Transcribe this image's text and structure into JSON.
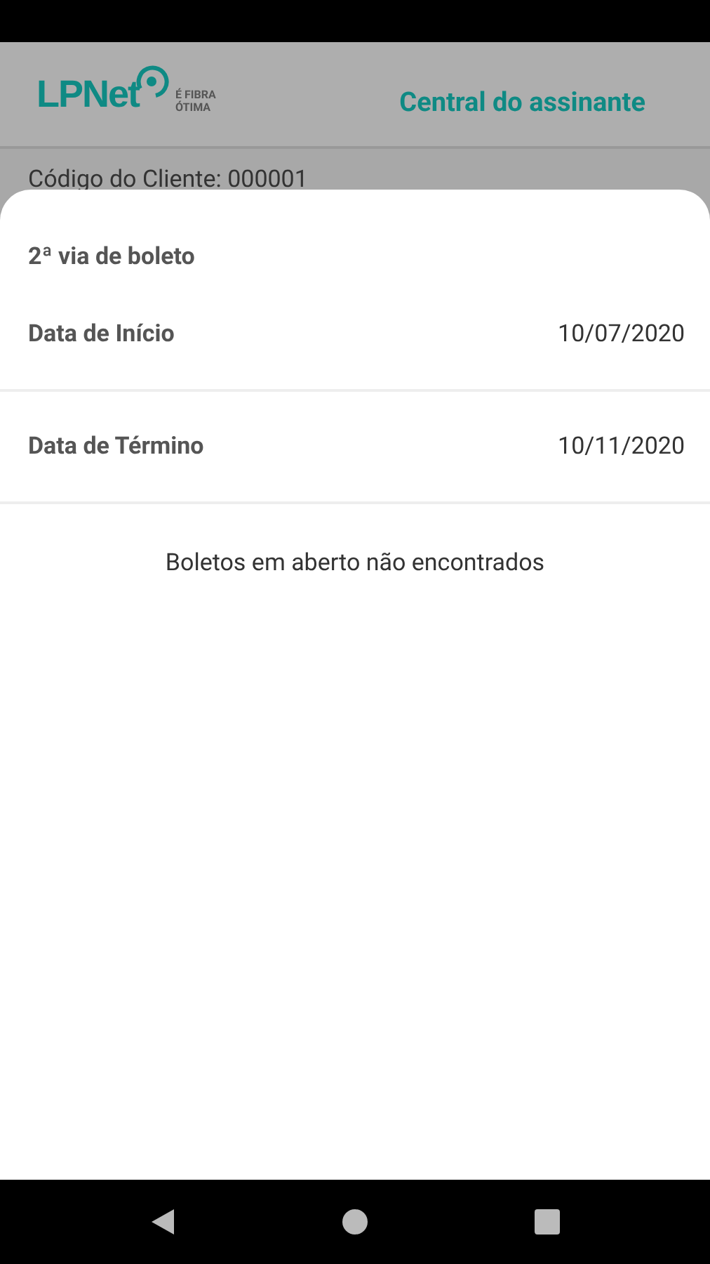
{
  "header": {
    "logo": "LPNet",
    "tagline": [
      "É FIBRA",
      "ÓTIMA"
    ],
    "title": "Central do assinante"
  },
  "client_code": "Código do Cliente: 000001",
  "sheet": {
    "title": "2ª via de boleto",
    "fields": [
      {
        "label": "Data de Início",
        "value": "10/07/2020"
      },
      {
        "label": "Data de Término",
        "value": "10/11/2020"
      }
    ],
    "message": "Boletos em aberto não encontrados"
  }
}
